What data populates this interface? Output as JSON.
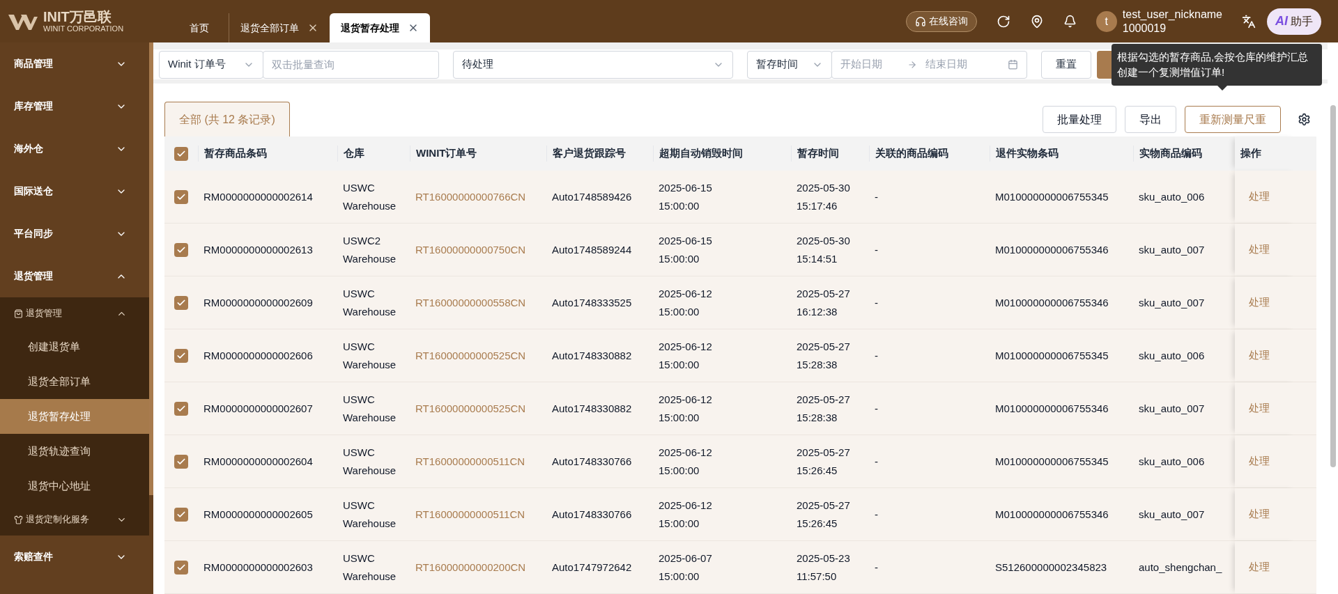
{
  "header": {
    "logo": {
      "name": "INIT万邑联",
      "subtitle": "WINIT CORPORATION"
    },
    "tabs": [
      {
        "label": "首页",
        "selected": false,
        "closable": false
      },
      {
        "label": "退货全部订单",
        "selected": false,
        "closable": true
      },
      {
        "label": "退货暂存处理",
        "selected": true,
        "closable": true
      }
    ],
    "consult": "在线咨询",
    "user": {
      "avatar": "t",
      "name": "test_user_nickname",
      "id": "1000019"
    },
    "ai": {
      "badge": "AI",
      "label": "助手"
    }
  },
  "sidebar": {
    "items": [
      {
        "label": "商品管理",
        "expanded": false
      },
      {
        "label": "库存管理",
        "expanded": false
      },
      {
        "label": "海外仓",
        "expanded": false
      },
      {
        "label": "国际送仓",
        "expanded": false
      },
      {
        "label": "平台同步",
        "expanded": false
      },
      {
        "label": "退货管理",
        "expanded": true,
        "children": [
          {
            "label": "退货管理",
            "expanded": true,
            "children": [
              {
                "label": "创建退货单",
                "selected": false
              },
              {
                "label": "退货全部订单",
                "selected": false
              },
              {
                "label": "退货暂存处理",
                "selected": true
              },
              {
                "label": "退货轨迹查询",
                "selected": false
              },
              {
                "label": "退货中心地址",
                "selected": false
              }
            ]
          },
          {
            "label": "退货定制化服务",
            "expanded": false
          }
        ]
      },
      {
        "label": "索赔查件",
        "expanded": false
      }
    ]
  },
  "filters": {
    "order_type": "Winit 订单号",
    "batch_search": {
      "placeholder": "双击批量查询"
    },
    "status": "待处理",
    "time_type": "暂存时间",
    "start_date": {
      "placeholder": "开始日期"
    },
    "end_date": {
      "placeholder": "结束日期"
    },
    "reset": "重置"
  },
  "tooltip": "根据勾选的暂存商品,会按仓库的维护汇总创建一个复测增值订单!",
  "records_tab": {
    "label": "全部 (共 12 条记录)",
    "selected": true
  },
  "actions": [
    "批量处理",
    "导出",
    "重新测量尺重"
  ],
  "table": {
    "all_selected": true,
    "columns": [
      {
        "label": "暂存商品条码",
        "kind": "text"
      },
      {
        "label": "仓库",
        "kind": "text"
      },
      {
        "label": "WINIT订单号",
        "kind": "link"
      },
      {
        "label": "客户退货跟踪号",
        "kind": "text"
      },
      {
        "label": "超期自动销毁时间",
        "kind": "text"
      },
      {
        "label": "暂存时间",
        "kind": "text"
      },
      {
        "label": "关联的商品编码",
        "kind": "text"
      },
      {
        "label": "退件实物条码",
        "kind": "text"
      },
      {
        "label": "实物商品编码",
        "kind": "text"
      }
    ],
    "action_column": "操作",
    "rows": [
      {
        "selected": true,
        "action": "处理",
        "cells": [
          "RM0000000000002614",
          "USWC\nWarehouse",
          "RT16000000000766CN",
          "Auto1748589426",
          "2025-06-15\n15:00:00",
          "2025-05-30\n15:17:46",
          "-",
          "M010000000006755345",
          "sku_auto_006"
        ]
      },
      {
        "selected": true,
        "action": "处理",
        "cells": [
          "RM0000000000002613",
          "USWC2\nWarehouse",
          "RT16000000000750CN",
          "Auto1748589244",
          "2025-06-15\n15:00:00",
          "2025-05-30\n15:14:51",
          "-",
          "M010000000006755346",
          "sku_auto_007"
        ]
      },
      {
        "selected": true,
        "action": "处理",
        "cells": [
          "RM0000000000002609",
          "USWC\nWarehouse",
          "RT16000000000558CN",
          "Auto1748333525",
          "2025-06-12\n15:00:00",
          "2025-05-27\n16:12:38",
          "-",
          "M010000000006755346",
          "sku_auto_007"
        ]
      },
      {
        "selected": true,
        "action": "处理",
        "cells": [
          "RM0000000000002606",
          "USWC\nWarehouse",
          "RT16000000000525CN",
          "Auto1748330882",
          "2025-06-12\n15:00:00",
          "2025-05-27\n15:28:38",
          "-",
          "M010000000006755345",
          "sku_auto_006"
        ]
      },
      {
        "selected": true,
        "action": "处理",
        "cells": [
          "RM0000000000002607",
          "USWC\nWarehouse",
          "RT16000000000525CN",
          "Auto1748330882",
          "2025-06-12\n15:00:00",
          "2025-05-27\n15:28:38",
          "-",
          "M010000000006755346",
          "sku_auto_007"
        ]
      },
      {
        "selected": true,
        "action": "处理",
        "cells": [
          "RM0000000000002604",
          "USWC\nWarehouse",
          "RT16000000000511CN",
          "Auto1748330766",
          "2025-06-12\n15:00:00",
          "2025-05-27\n15:26:45",
          "-",
          "M010000000006755345",
          "sku_auto_006"
        ]
      },
      {
        "selected": true,
        "action": "处理",
        "cells": [
          "RM0000000000002605",
          "USWC\nWarehouse",
          "RT16000000000511CN",
          "Auto1748330766",
          "2025-06-12\n15:00:00",
          "2025-05-27\n15:26:45",
          "-",
          "M010000000006755346",
          "sku_auto_007"
        ]
      },
      {
        "selected": true,
        "action": "处理",
        "cells": [
          "RM0000000000002603",
          "USWC\nWarehouse",
          "RT16000000000200CN",
          "Auto1747972642",
          "2025-06-07\n15:00:00",
          "2025-05-23\n11:57:50",
          "-",
          "S512600000002345823",
          "auto_shengchan_"
        ]
      }
    ]
  }
}
